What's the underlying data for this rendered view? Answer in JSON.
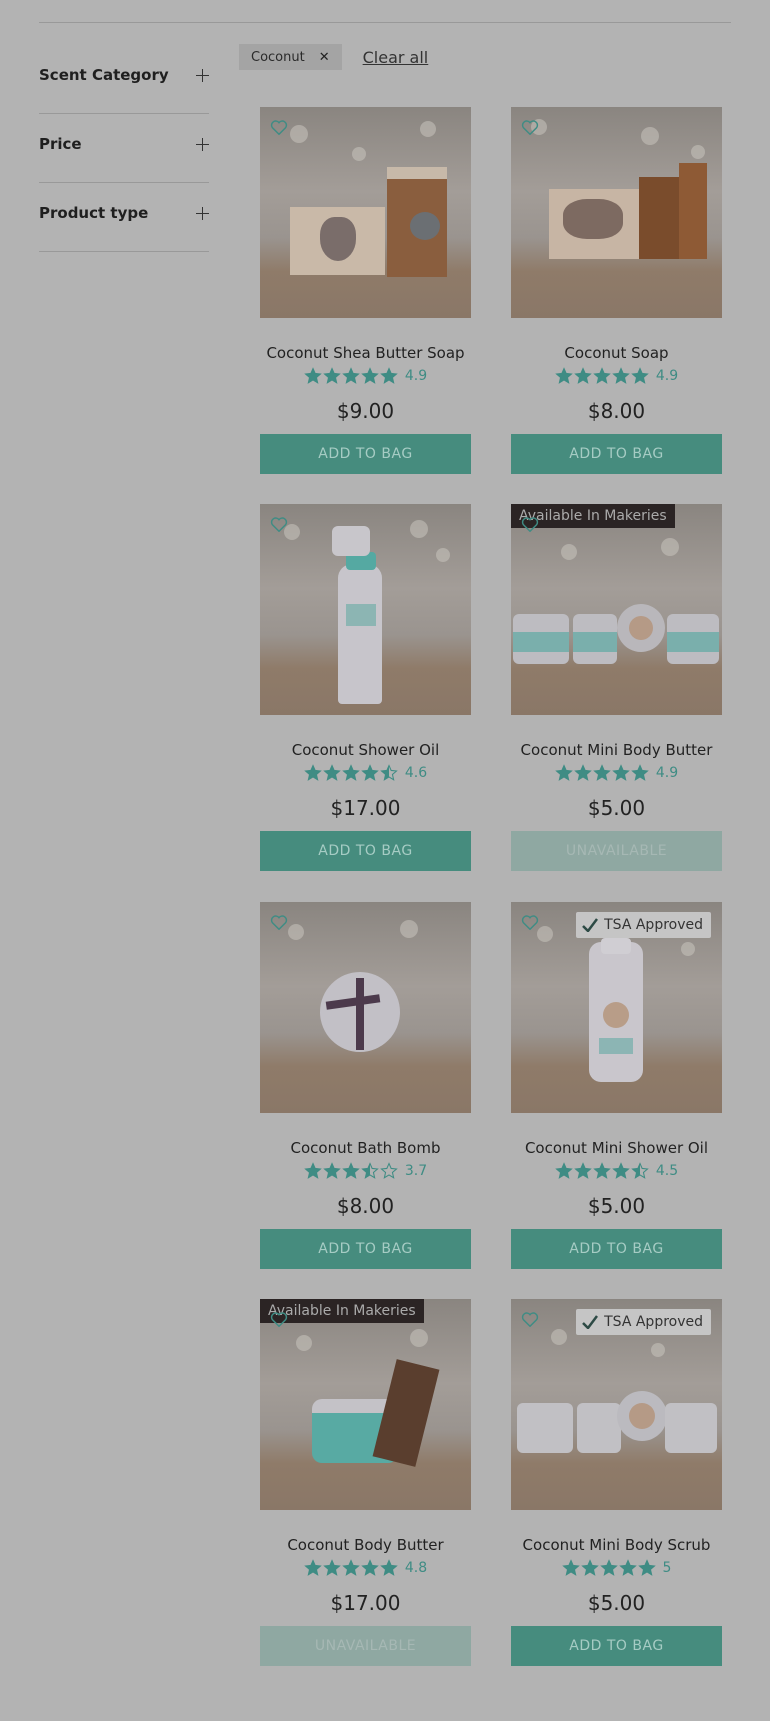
{
  "filters": {
    "facets": [
      {
        "label": "Scent Category"
      },
      {
        "label": "Price"
      },
      {
        "label": "Product type"
      }
    ],
    "active": [
      {
        "label": "Coconut"
      }
    ],
    "clear_all_label": "Clear all"
  },
  "colors": {
    "accent": "#468c7e",
    "star": "#3f8c84",
    "badge_dark": "#2b2424"
  },
  "products": [
    {
      "name": "Coconut Shea Butter Soap",
      "rating": "4.9",
      "rating_value": 4.9,
      "price": "$9.00",
      "button": "ADD TO BAG",
      "available": true,
      "badge": null
    },
    {
      "name": "Coconut Soap",
      "rating": "4.9",
      "rating_value": 4.9,
      "price": "$8.00",
      "button": "ADD TO BAG",
      "available": true,
      "badge": null
    },
    {
      "name": "Coconut Shower Oil",
      "rating": "4.6",
      "rating_value": 4.6,
      "price": "$17.00",
      "button": "ADD TO BAG",
      "available": true,
      "badge": null
    },
    {
      "name": "Coconut Mini Body Butter",
      "rating": "4.9",
      "rating_value": 4.9,
      "price": "$5.00",
      "button": "UNAVAILABLE",
      "available": false,
      "badge": "Available In Makeries"
    },
    {
      "name": "Coconut Bath Bomb",
      "rating": "3.7",
      "rating_value": 3.7,
      "price": "$8.00",
      "button": "ADD TO BAG",
      "available": true,
      "badge": null
    },
    {
      "name": "Coconut Mini Shower Oil",
      "rating": "4.5",
      "rating_value": 4.5,
      "price": "$5.00",
      "button": "ADD TO BAG",
      "available": true,
      "badge": "TSA Approved"
    },
    {
      "name": "Coconut Body Butter",
      "rating": "4.8",
      "rating_value": 4.8,
      "price": "$17.00",
      "button": "UNAVAILABLE",
      "available": false,
      "badge": "Available In Makeries"
    },
    {
      "name": "Coconut Mini Body Scrub",
      "rating": "5",
      "rating_value": 5,
      "price": "$5.00",
      "button": "ADD TO BAG",
      "available": true,
      "badge": "TSA Approved"
    }
  ]
}
